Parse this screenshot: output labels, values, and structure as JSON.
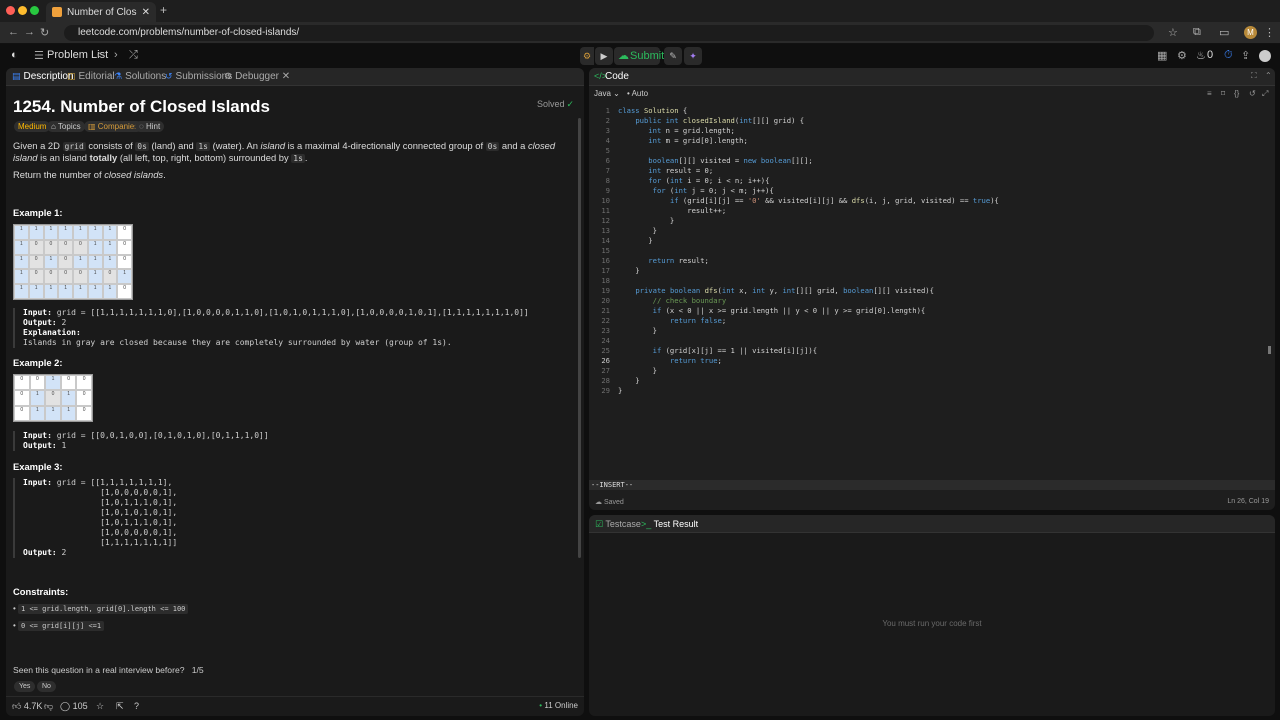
{
  "browser": {
    "tab_title": "Number of Closed Islands - L",
    "url": "leetcode.com/problems/number-of-closed-islands/",
    "profile_initial": "M"
  },
  "nav": {
    "problem_list": "Problem List",
    "submit": "Submit",
    "streak": "0"
  },
  "left": {
    "tabs": [
      "Description",
      "Editorial",
      "Solutions",
      "Submissions",
      "Debugger"
    ],
    "title": "1254. Number of Closed Islands",
    "solved": "Solved",
    "tags": [
      "Medium",
      "Topics",
      "Companies",
      "Hint"
    ],
    "desc": {
      "p1_a": "Given a 2D ",
      "p1_grid": "grid",
      "p1_b": " consists of ",
      "p1_0s": "0s",
      "p1_c": " (land) and ",
      "p1_1s": "1s",
      "p1_d": " (water).  An ",
      "p1_island": "island",
      "p1_e": " is a maximal 4-directionally connected group of ",
      "p1_0s_b": "0s",
      "p1_f": " and a ",
      "p1_closed": "closed island",
      "p1_g": " is an island ",
      "p1_totally": "totally",
      "p1_h": " (all left, top, right, bottom) surrounded by ",
      "p1_1s_b": "1s",
      "p1_i": ".",
      "p2_a": "Return the number of ",
      "p2_em": "closed islands",
      "p2_b": "."
    },
    "ex1": {
      "heading": "Example 1:",
      "input_label": "Input:",
      "input": " grid = [[1,1,1,1,1,1,1,0],[1,0,0,0,0,1,1,0],[1,0,1,0,1,1,1,0],[1,0,0,0,0,1,0,1],[1,1,1,1,1,1,1,0]]",
      "output_label": "Output:",
      "output": " 2",
      "expl_label": "Explanation:",
      "expl": "Islands in gray are closed because they are completely surrounded by water (group of 1s)."
    },
    "ex2": {
      "heading": "Example 2:",
      "input_label": "Input:",
      "input": " grid = [[0,0,1,0,0],[0,1,0,1,0],[0,1,1,1,0]]",
      "output_label": "Output:",
      "output": " 1"
    },
    "ex3": {
      "heading": "Example 3:",
      "input_label": "Input:",
      "input_lines": [
        " grid = [[1,1,1,1,1,1,1],",
        "         [1,0,0,0,0,0,1],",
        "         [1,0,1,1,1,0,1],",
        "         [1,0,1,0,1,0,1],",
        "         [1,0,1,1,1,0,1],",
        "         [1,0,0,0,0,0,1],",
        "         [1,1,1,1,1,1,1]]"
      ],
      "output_label": "Output:",
      "output": " 2"
    },
    "constraints_heading": "Constraints:",
    "constraints": [
      "1 <= grid.length, grid[0].length <= 100",
      "0 <= grid[i][j] <=1"
    ],
    "seen": "Seen this question in a real interview before?",
    "seen_count": "1/5",
    "yes": "Yes",
    "no": "No",
    "likes": "4.7K",
    "comments": "105",
    "online": "11 Online"
  },
  "grids": {
    "ex1": [
      [
        1,
        1,
        1,
        1,
        1,
        1,
        1,
        0
      ],
      [
        1,
        0,
        0,
        0,
        0,
        1,
        1,
        0
      ],
      [
        1,
        0,
        1,
        0,
        1,
        1,
        1,
        0
      ],
      [
        1,
        0,
        0,
        0,
        0,
        1,
        0,
        1
      ],
      [
        1,
        1,
        1,
        1,
        1,
        1,
        1,
        0
      ]
    ],
    "ex2": [
      [
        0,
        0,
        1,
        0,
        0
      ],
      [
        0,
        1,
        0,
        1,
        0
      ],
      [
        0,
        1,
        1,
        1,
        0
      ]
    ]
  },
  "code": {
    "title": "Code",
    "lang": "Java",
    "auto": "Auto",
    "lines": [
      "class Solution {",
      "    public int closedIsland(int[][] grid) {",
      "       int n = grid.length;",
      "       int m = grid[0].length;",
      "",
      "       boolean[][] visited = new boolean[][];",
      "       int result = 0;",
      "       for (int i = 0; i < n; i++){",
      "        for (int j = 0; j < m; j++){",
      "            if (grid[i][j] == '0' && visited[i][j] && dfs(i, j, grid, visited) == true){",
      "                result++;",
      "            }",
      "        }",
      "       }",
      "",
      "       return result;",
      "    }",
      "",
      "    private boolean dfs(int x, int y, int[][] grid, boolean[][] visited){",
      "        // check boundary",
      "        if (x < 0 || x >= grid.length || y < 0 || y >= grid[0].length){",
      "            return false;",
      "        }",
      "",
      "        if (grid[x][j] == 1 || visited[i][j]){",
      "            return true;",
      "        }",
      "    }",
      "}"
    ],
    "mode": "--INSERT--",
    "saved": "Saved",
    "position": "Ln 26, Col 19"
  },
  "test": {
    "tabs": [
      "Testcase",
      "Test Result"
    ],
    "placeholder": "You must run your code first"
  }
}
